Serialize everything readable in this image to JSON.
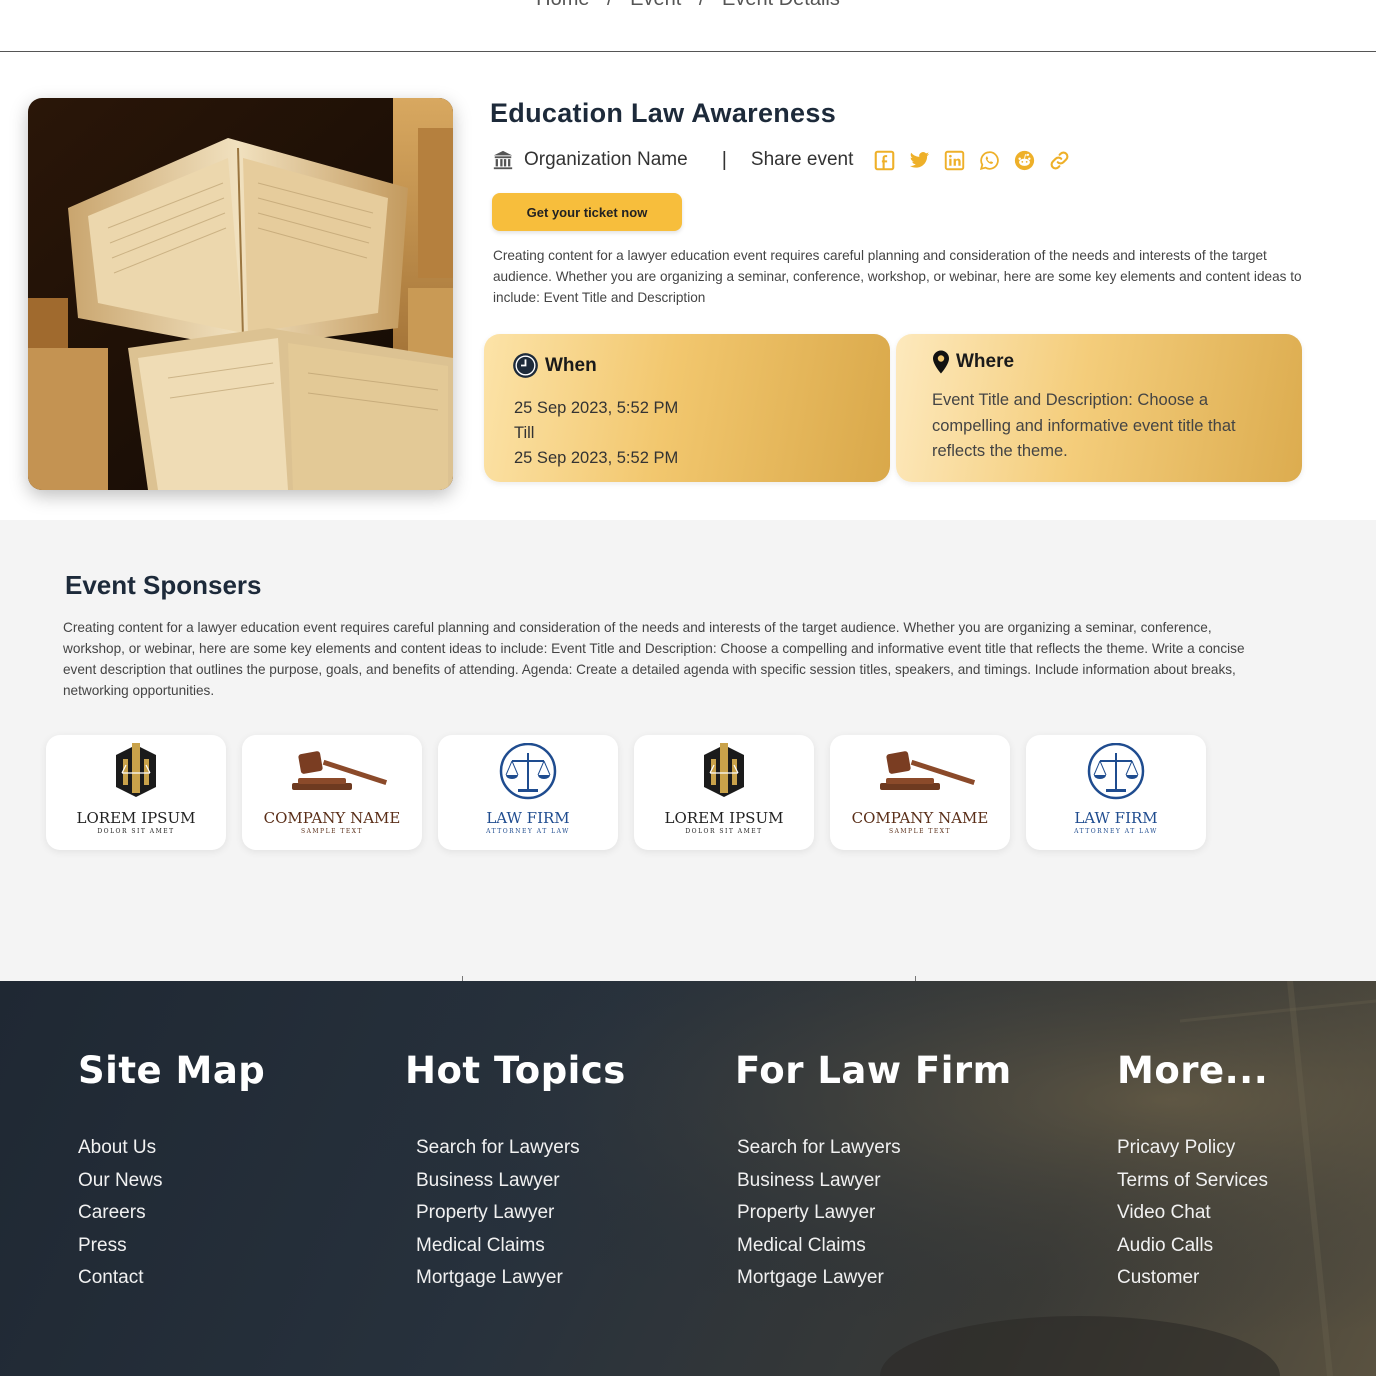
{
  "breadcrumb": {
    "home": "Home",
    "sep1": "/",
    "event": "Event",
    "sep2": "/",
    "current": "Event Details"
  },
  "event": {
    "title": "Education Law Awareness",
    "organization": "Organization Name",
    "separator": "|",
    "share_label": "Share event",
    "share_icons": [
      "facebook-icon",
      "twitter-icon",
      "linkedin-icon",
      "whatsapp-icon",
      "reddit-icon",
      "link-icon"
    ],
    "ticket_button": "Get your ticket now",
    "description": "Creating content for a lawyer education event requires careful planning and consideration of the needs and interests of the target audience. Whether you are organizing a seminar, conference, workshop, or webinar, here are some key elements and content ideas to include: Event Title and Description",
    "when": {
      "heading": "When",
      "start": "25 Sep 2023,  5:52 PM",
      "till": "Till",
      "end": "25 Sep 2023,  5:52 PM"
    },
    "where": {
      "heading": "Where",
      "text": "Event Title and Description: Choose a compelling and informative event title that reflects the theme."
    }
  },
  "sponsors": {
    "title": "Event Sponsers",
    "description": "Creating content for a lawyer education event requires careful planning and consideration of the needs and interests of the target audience. Whether you are organizing a seminar, conference, workshop, or webinar, here are some key elements and content ideas to include: Event Title and Description: Choose a compelling and informative event title that reflects the theme. Write a concise event description that outlines the purpose, goals, and benefits of attending. Agenda: Create a detailed agenda with specific session titles, speakers, and timings. Include information about breaks, networking opportunities.",
    "logos": [
      {
        "name": "LOREM IPSUM",
        "sub": "DOLOR SIT AMET",
        "kind": "tower"
      },
      {
        "name": "COMPANY NAME",
        "sub": "SAMPLE TEXT",
        "kind": "gavel"
      },
      {
        "name": "LAW FIRM",
        "sub": "ATTORNEY AT LAW",
        "kind": "scales"
      },
      {
        "name": "LOREM IPSUM",
        "sub": "DOLOR SIT AMET",
        "kind": "tower"
      },
      {
        "name": "COMPANY NAME",
        "sub": "SAMPLE TEXT",
        "kind": "gavel"
      },
      {
        "name": "LAW FIRM",
        "sub": "ATTORNEY AT LAW",
        "kind": "scales"
      }
    ]
  },
  "footer": {
    "columns": [
      {
        "heading": "Site Map",
        "links": [
          "About Us",
          "Our News",
          "Careers",
          "Press",
          "Contact"
        ]
      },
      {
        "heading": "Hot Topics",
        "links": [
          "Search for Lawyers",
          "Business Lawyer",
          "Property Lawyer",
          "Medical Claims",
          "Mortgage Lawyer"
        ]
      },
      {
        "heading": "For Law Firm",
        "links": [
          "Search for Lawyers",
          "Business Lawyer",
          "Property Lawyer",
          "Medical Claims",
          "Mortgage Lawyer"
        ]
      },
      {
        "heading": "More...",
        "links": [
          "Pricavy Policy",
          "Terms of Services",
          "Video Chat",
          "Audio Calls",
          "Customer"
        ]
      }
    ]
  },
  "colors": {
    "accent": "#f7be3c",
    "share_icon": "#eeb029",
    "title": "#1d2a3a",
    "footer_bg": "#1f2833"
  }
}
